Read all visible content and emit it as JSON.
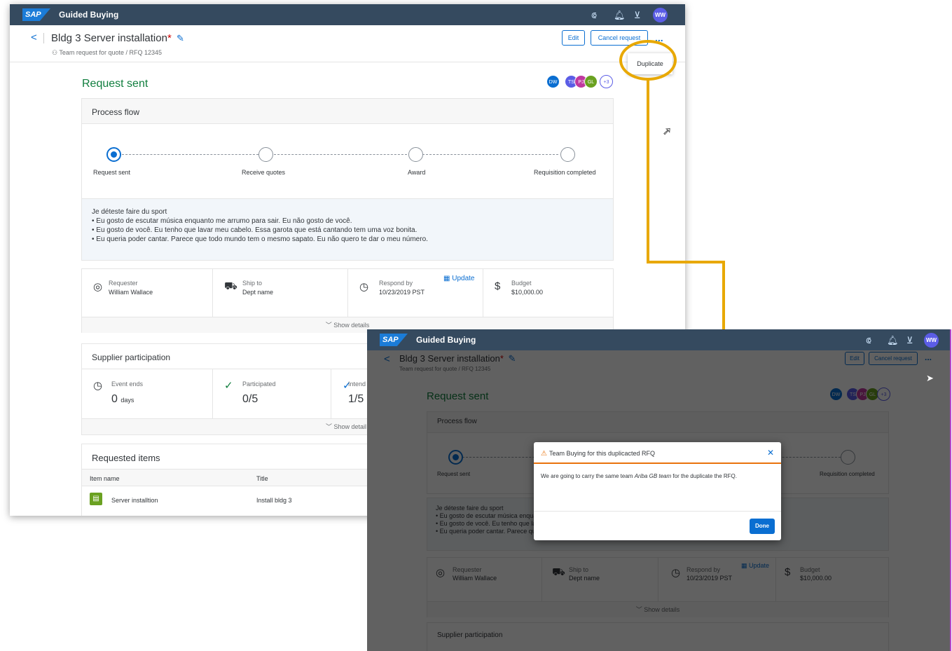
{
  "shell": {
    "app_title": "Guided Buying",
    "logo": "SAP",
    "avatar": "WW"
  },
  "header": {
    "title": "Bldg 3 Server installation",
    "asterisk": "*",
    "subtitle": "Team request for quote  /  RFQ 12345",
    "edit_label": "Edit",
    "cancel_label": "Cancel request",
    "more_label": "...",
    "duplicate_label": "Duplicate"
  },
  "status": {
    "title": "Request sent"
  },
  "collaborators": {
    "avatars": [
      "DW",
      "TS",
      "PJ",
      "GL"
    ],
    "more": "+3"
  },
  "process_flow": {
    "title": "Process flow",
    "steps": [
      "Request sent",
      "Receive quotes",
      "Award",
      "Requisition completed"
    ]
  },
  "note": {
    "heading": "Je déteste faire du sport",
    "lines": [
      "• Eu gosto de escutar música enquanto me arrumo para sair. Eu não gosto de você.",
      "• Eu gosto de você. Eu tenho que lavar meu cabelo. Essa garota que está cantando tem uma voz bonita.",
      "• Eu queria poder cantar. Parece que todo mundo tem o mesmo sapato. Eu não quero te dar o meu número."
    ]
  },
  "info": {
    "requester_label": "Requester",
    "requester_value": "William Wallace",
    "ship_label": "Ship to",
    "ship_value": "Dept name",
    "respond_label": "Respond by",
    "respond_value": "10/23/2019 PST",
    "update_label": "Update",
    "budget_label": "Budget",
    "budget_value": "$10,000.00",
    "show_details": "Show details"
  },
  "supplier": {
    "title": "Supplier participation",
    "event_label": "Event ends",
    "event_value": "0",
    "event_unit": "days",
    "participated_label": "Participated",
    "participated_value": "0/5",
    "intend_label": "Intend",
    "intend_value": "1/5",
    "show_details": "Show detail"
  },
  "items": {
    "title": "Requested items",
    "columns": [
      "Item name",
      "Title"
    ],
    "rows": [
      {
        "name": "Server installtion",
        "title": "Install bldg 3"
      }
    ]
  },
  "dialog": {
    "title": "Team Buying for this duplicacted RFQ",
    "body_pre": "We are going to carry the same team ",
    "body_team": "Ariba GB team",
    "body_post": " for the duplicate the RFQ.",
    "done_label": "Done",
    "close_label": "✕"
  },
  "colors": {
    "shell": "#354a5f",
    "accent": "#0a6ed1",
    "success": "#107e3e",
    "annotation": "#e8a800",
    "warning": "#e9730c"
  }
}
